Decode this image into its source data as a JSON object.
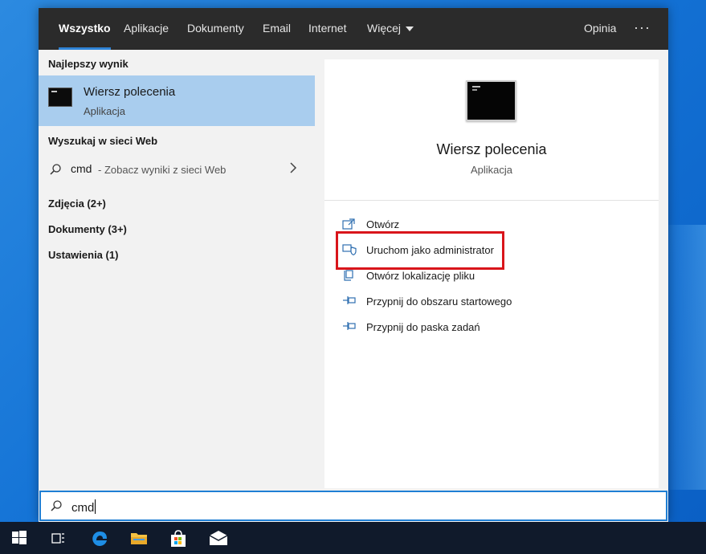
{
  "tabs": [
    {
      "label": "Wszystko"
    },
    {
      "label": "Aplikacje"
    },
    {
      "label": "Dokumenty"
    },
    {
      "label": "Email"
    },
    {
      "label": "Internet"
    },
    {
      "label": "Więcej"
    }
  ],
  "topbar": {
    "feedback_label": "Opinia",
    "more_label": "···"
  },
  "left": {
    "best_match_title": "Najlepszy wynik",
    "best_match": {
      "name": "Wiersz polecenia",
      "type": "Aplikacja"
    },
    "web_title": "Wyszukaj w sieci Web",
    "web_result": {
      "query": "cmd",
      "sub": "- Zobacz wyniki z sieci Web"
    },
    "categories": [
      {
        "label": "Zdjęcia (2+)"
      },
      {
        "label": "Dokumenty (3+)"
      },
      {
        "label": "Ustawienia (1)"
      }
    ]
  },
  "details": {
    "name": "Wiersz polecenia",
    "type": "Aplikacja",
    "actions": [
      {
        "label": "Otwórz",
        "icon": "open-icon"
      },
      {
        "label": "Uruchom jako administrator",
        "icon": "shield-icon"
      },
      {
        "label": "Otwórz lokalizację pliku",
        "icon": "file-location-icon"
      },
      {
        "label": "Przypnij do obszaru startowego",
        "icon": "pin-icon"
      },
      {
        "label": "Przypnij do paska zadań",
        "icon": "pin-icon"
      }
    ],
    "highlight_color": "#d9151b"
  },
  "search": {
    "value": "cmd"
  },
  "colors": {
    "accent": "#2f84d7",
    "selected_row": "#a9cdee",
    "topbar": "#2b2b2b",
    "taskbar": "#101a2b"
  },
  "taskbar": {
    "items": [
      {
        "icon": "windows-start-icon"
      },
      {
        "icon": "task-view-icon"
      },
      {
        "icon": "edge-browser-icon"
      },
      {
        "icon": "file-explorer-icon"
      },
      {
        "icon": "store-icon"
      },
      {
        "icon": "mail-icon"
      }
    ]
  }
}
